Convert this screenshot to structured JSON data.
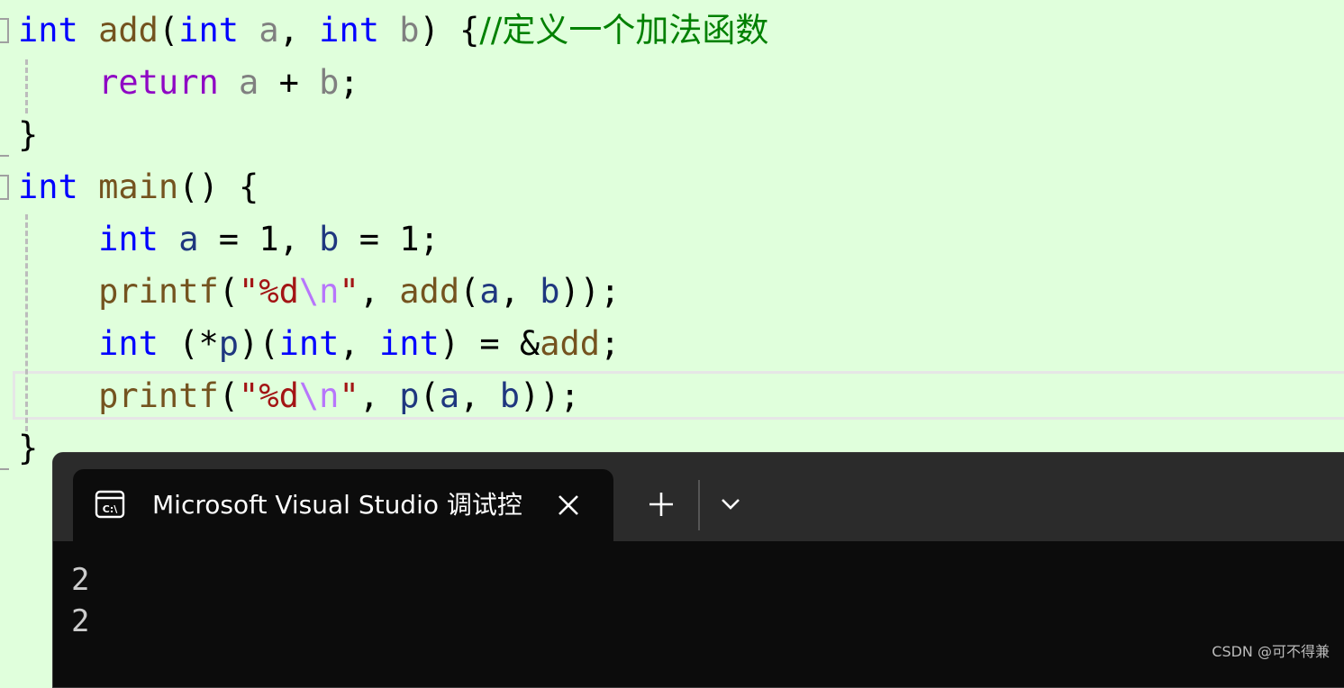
{
  "code": {
    "lines": [
      [
        {
          "t": "int",
          "c": "tok-kw"
        },
        {
          "t": " ",
          "c": ""
        },
        {
          "t": "add",
          "c": "tok-fn"
        },
        {
          "t": "(",
          "c": "tok-op"
        },
        {
          "t": "int",
          "c": "tok-kw"
        },
        {
          "t": " ",
          "c": ""
        },
        {
          "t": "a",
          "c": "tok-param"
        },
        {
          "t": ", ",
          "c": "tok-op"
        },
        {
          "t": "int",
          "c": "tok-kw"
        },
        {
          "t": " ",
          "c": ""
        },
        {
          "t": "b",
          "c": "tok-param"
        },
        {
          "t": ") {",
          "c": "tok-op"
        },
        {
          "t": "//定义一个加法函数",
          "c": "tok-cmt"
        }
      ],
      [
        {
          "t": "    ",
          "c": ""
        },
        {
          "t": "return",
          "c": "tok-ctl"
        },
        {
          "t": " ",
          "c": ""
        },
        {
          "t": "a",
          "c": "tok-param"
        },
        {
          "t": " + ",
          "c": "tok-op"
        },
        {
          "t": "b",
          "c": "tok-param"
        },
        {
          "t": ";",
          "c": "tok-op"
        }
      ],
      [
        {
          "t": "}",
          "c": "tok-op"
        }
      ],
      [
        {
          "t": "int",
          "c": "tok-kw"
        },
        {
          "t": " ",
          "c": ""
        },
        {
          "t": "main",
          "c": "tok-fn"
        },
        {
          "t": "() {",
          "c": "tok-op"
        }
      ],
      [
        {
          "t": "    ",
          "c": ""
        },
        {
          "t": "int",
          "c": "tok-kw"
        },
        {
          "t": " ",
          "c": ""
        },
        {
          "t": "a",
          "c": "tok-var"
        },
        {
          "t": " = 1, ",
          "c": "tok-op"
        },
        {
          "t": "b",
          "c": "tok-var"
        },
        {
          "t": " = 1;",
          "c": "tok-op"
        }
      ],
      [
        {
          "t": "    ",
          "c": ""
        },
        {
          "t": "printf",
          "c": "tok-fn"
        },
        {
          "t": "(",
          "c": "tok-op"
        },
        {
          "t": "\"%d",
          "c": "tok-str"
        },
        {
          "t": "\\n",
          "c": "tok-esc"
        },
        {
          "t": "\"",
          "c": "tok-str"
        },
        {
          "t": ", ",
          "c": "tok-op"
        },
        {
          "t": "add",
          "c": "tok-fn"
        },
        {
          "t": "(",
          "c": "tok-op"
        },
        {
          "t": "a",
          "c": "tok-var"
        },
        {
          "t": ", ",
          "c": "tok-op"
        },
        {
          "t": "b",
          "c": "tok-var"
        },
        {
          "t": "));",
          "c": "tok-op"
        }
      ],
      [
        {
          "t": "    ",
          "c": ""
        },
        {
          "t": "int",
          "c": "tok-kw"
        },
        {
          "t": " (*",
          "c": "tok-op"
        },
        {
          "t": "p",
          "c": "tok-var"
        },
        {
          "t": ")(",
          "c": "tok-op"
        },
        {
          "t": "int",
          "c": "tok-kw"
        },
        {
          "t": ", ",
          "c": "tok-op"
        },
        {
          "t": "int",
          "c": "tok-kw"
        },
        {
          "t": ") = &",
          "c": "tok-op"
        },
        {
          "t": "add",
          "c": "tok-fn"
        },
        {
          "t": ";",
          "c": "tok-op"
        }
      ],
      [
        {
          "t": "    ",
          "c": ""
        },
        {
          "t": "printf",
          "c": "tok-fn"
        },
        {
          "t": "(",
          "c": "tok-op"
        },
        {
          "t": "\"%d",
          "c": "tok-str"
        },
        {
          "t": "\\n",
          "c": "tok-esc"
        },
        {
          "t": "\"",
          "c": "tok-str"
        },
        {
          "t": ", ",
          "c": "tok-op"
        },
        {
          "t": "p",
          "c": "tok-var"
        },
        {
          "t": "(",
          "c": "tok-op"
        },
        {
          "t": "a",
          "c": "tok-var"
        },
        {
          "t": ", ",
          "c": "tok-op"
        },
        {
          "t": "b",
          "c": "tok-var"
        },
        {
          "t": "));",
          "c": "tok-op"
        }
      ],
      [
        {
          "t": "}",
          "c": "tok-op"
        }
      ]
    ]
  },
  "terminal": {
    "tab_title": "Microsoft Visual Studio 调试控",
    "icon": "console-icon",
    "output": [
      "2",
      "2"
    ]
  },
  "watermark": "CSDN @可不得兼",
  "colors": {
    "editor_background": "#e0ffdc",
    "keyword": "#0000ff",
    "function": "#74531f",
    "parameter": "#808080",
    "local_variable": "#1f377f",
    "control_keyword": "#8f08c4",
    "string": "#a31515",
    "escape": "#b776fb",
    "comment": "#008000",
    "terminal_background": "#0c0c0c",
    "tabbar_background": "#2b2b2b"
  }
}
